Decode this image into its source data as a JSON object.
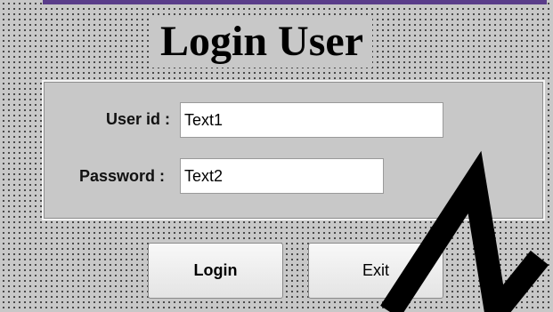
{
  "form": {
    "title": "Login User",
    "userid_label": "User id :",
    "password_label": "Password :",
    "userid_value": "Text1",
    "password_value": "Text2",
    "login_button": "Login",
    "exit_button": "Exit"
  },
  "colors": {
    "background": "#c8c8c8",
    "top_bar": "#5a3d8a",
    "watermark": "#000000"
  }
}
